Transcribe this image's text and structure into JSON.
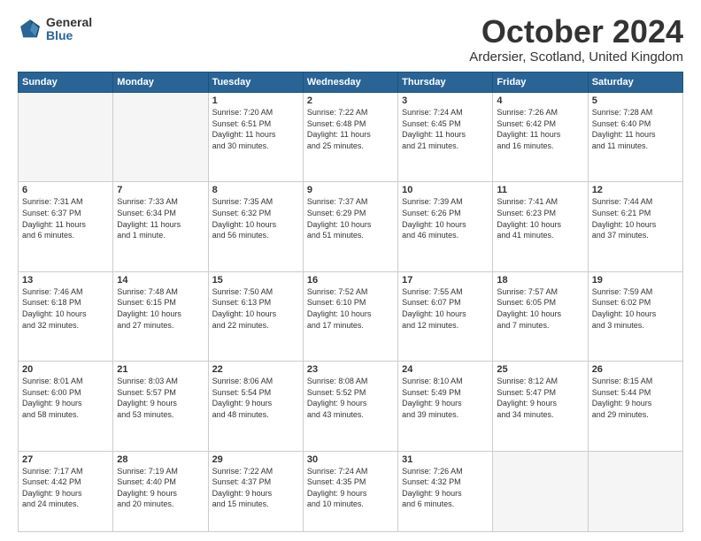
{
  "logo": {
    "general": "General",
    "blue": "Blue"
  },
  "title": "October 2024",
  "subtitle": "Ardersier, Scotland, United Kingdom",
  "weekdays": [
    "Sunday",
    "Monday",
    "Tuesday",
    "Wednesday",
    "Thursday",
    "Friday",
    "Saturday"
  ],
  "weeks": [
    [
      {
        "day": "",
        "info": ""
      },
      {
        "day": "",
        "info": ""
      },
      {
        "day": "1",
        "info": "Sunrise: 7:20 AM\nSunset: 6:51 PM\nDaylight: 11 hours\nand 30 minutes."
      },
      {
        "day": "2",
        "info": "Sunrise: 7:22 AM\nSunset: 6:48 PM\nDaylight: 11 hours\nand 25 minutes."
      },
      {
        "day": "3",
        "info": "Sunrise: 7:24 AM\nSunset: 6:45 PM\nDaylight: 11 hours\nand 21 minutes."
      },
      {
        "day": "4",
        "info": "Sunrise: 7:26 AM\nSunset: 6:42 PM\nDaylight: 11 hours\nand 16 minutes."
      },
      {
        "day": "5",
        "info": "Sunrise: 7:28 AM\nSunset: 6:40 PM\nDaylight: 11 hours\nand 11 minutes."
      }
    ],
    [
      {
        "day": "6",
        "info": "Sunrise: 7:31 AM\nSunset: 6:37 PM\nDaylight: 11 hours\nand 6 minutes."
      },
      {
        "day": "7",
        "info": "Sunrise: 7:33 AM\nSunset: 6:34 PM\nDaylight: 11 hours\nand 1 minute."
      },
      {
        "day": "8",
        "info": "Sunrise: 7:35 AM\nSunset: 6:32 PM\nDaylight: 10 hours\nand 56 minutes."
      },
      {
        "day": "9",
        "info": "Sunrise: 7:37 AM\nSunset: 6:29 PM\nDaylight: 10 hours\nand 51 minutes."
      },
      {
        "day": "10",
        "info": "Sunrise: 7:39 AM\nSunset: 6:26 PM\nDaylight: 10 hours\nand 46 minutes."
      },
      {
        "day": "11",
        "info": "Sunrise: 7:41 AM\nSunset: 6:23 PM\nDaylight: 10 hours\nand 41 minutes."
      },
      {
        "day": "12",
        "info": "Sunrise: 7:44 AM\nSunset: 6:21 PM\nDaylight: 10 hours\nand 37 minutes."
      }
    ],
    [
      {
        "day": "13",
        "info": "Sunrise: 7:46 AM\nSunset: 6:18 PM\nDaylight: 10 hours\nand 32 minutes."
      },
      {
        "day": "14",
        "info": "Sunrise: 7:48 AM\nSunset: 6:15 PM\nDaylight: 10 hours\nand 27 minutes."
      },
      {
        "day": "15",
        "info": "Sunrise: 7:50 AM\nSunset: 6:13 PM\nDaylight: 10 hours\nand 22 minutes."
      },
      {
        "day": "16",
        "info": "Sunrise: 7:52 AM\nSunset: 6:10 PM\nDaylight: 10 hours\nand 17 minutes."
      },
      {
        "day": "17",
        "info": "Sunrise: 7:55 AM\nSunset: 6:07 PM\nDaylight: 10 hours\nand 12 minutes."
      },
      {
        "day": "18",
        "info": "Sunrise: 7:57 AM\nSunset: 6:05 PM\nDaylight: 10 hours\nand 7 minutes."
      },
      {
        "day": "19",
        "info": "Sunrise: 7:59 AM\nSunset: 6:02 PM\nDaylight: 10 hours\nand 3 minutes."
      }
    ],
    [
      {
        "day": "20",
        "info": "Sunrise: 8:01 AM\nSunset: 6:00 PM\nDaylight: 9 hours\nand 58 minutes."
      },
      {
        "day": "21",
        "info": "Sunrise: 8:03 AM\nSunset: 5:57 PM\nDaylight: 9 hours\nand 53 minutes."
      },
      {
        "day": "22",
        "info": "Sunrise: 8:06 AM\nSunset: 5:54 PM\nDaylight: 9 hours\nand 48 minutes."
      },
      {
        "day": "23",
        "info": "Sunrise: 8:08 AM\nSunset: 5:52 PM\nDaylight: 9 hours\nand 43 minutes."
      },
      {
        "day": "24",
        "info": "Sunrise: 8:10 AM\nSunset: 5:49 PM\nDaylight: 9 hours\nand 39 minutes."
      },
      {
        "day": "25",
        "info": "Sunrise: 8:12 AM\nSunset: 5:47 PM\nDaylight: 9 hours\nand 34 minutes."
      },
      {
        "day": "26",
        "info": "Sunrise: 8:15 AM\nSunset: 5:44 PM\nDaylight: 9 hours\nand 29 minutes."
      }
    ],
    [
      {
        "day": "27",
        "info": "Sunrise: 7:17 AM\nSunset: 4:42 PM\nDaylight: 9 hours\nand 24 minutes."
      },
      {
        "day": "28",
        "info": "Sunrise: 7:19 AM\nSunset: 4:40 PM\nDaylight: 9 hours\nand 20 minutes."
      },
      {
        "day": "29",
        "info": "Sunrise: 7:22 AM\nSunset: 4:37 PM\nDaylight: 9 hours\nand 15 minutes."
      },
      {
        "day": "30",
        "info": "Sunrise: 7:24 AM\nSunset: 4:35 PM\nDaylight: 9 hours\nand 10 minutes."
      },
      {
        "day": "31",
        "info": "Sunrise: 7:26 AM\nSunset: 4:32 PM\nDaylight: 9 hours\nand 6 minutes."
      },
      {
        "day": "",
        "info": ""
      },
      {
        "day": "",
        "info": ""
      }
    ]
  ]
}
